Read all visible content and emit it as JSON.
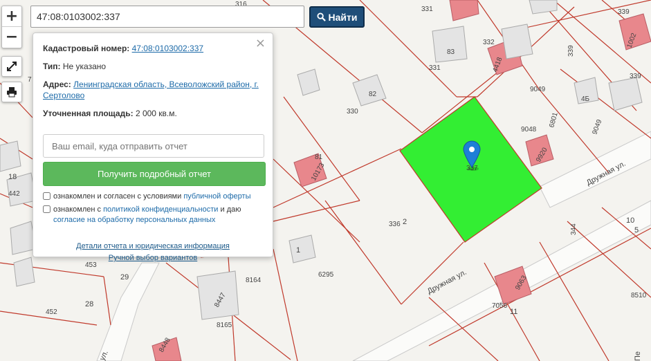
{
  "search": {
    "value": "47:08:0103002:337",
    "button_label": "Найти"
  },
  "map_controls": {
    "zoom_in": "+",
    "zoom_out": "−"
  },
  "popup": {
    "close": "×",
    "cadastral_label": "Кадастровый номер:",
    "cadastral_value": "47:08:0103002:337",
    "type_label": "Тип:",
    "type_value": "Не указано",
    "address_label": "Адрес:",
    "address_value": "Ленинградская область, Всеволожский район, г. Сертолово",
    "area_label": "Уточненная площадь:",
    "area_value": "2 000 кв.м.",
    "email_placeholder": "Ваш email, куда отправить отчет",
    "report_button": "Получить подробный отчет",
    "check1_text": "ознакомлен и согласен с условиями ",
    "check1_link": "публичной оферты",
    "check2_text": "ознакомлен с ",
    "check2_link1": "политикой конфиденциальности",
    "check2_mid": " и даю ",
    "check2_link2": "согласие на обработку персональных данных",
    "details_link": "Детали отчета и юридическая информация",
    "manual_link": "Ручной выбор вариантов"
  },
  "map_labels": {
    "l331a": "331",
    "l339a": "339",
    "l1002": "1002",
    "l83": "83",
    "l332": "332",
    "l4418": "4418",
    "l331b": "331",
    "l339b": "339",
    "l339c": "339",
    "l82": "82",
    "l9049a": "9049",
    "l4b": "4Б",
    "l330": "330",
    "l6801": "6801",
    "l9049b": "9049",
    "l9048": "9048",
    "l9920": "9920",
    "l337": "337",
    "l81": "81",
    "l10173": "10173",
    "l18": "18",
    "l442": "442",
    "l336": "336",
    "l2": "2",
    "l10": "10",
    "l344": "344",
    "l5": "5",
    "l1": "1",
    "l453": "453",
    "l29": "29",
    "l8164": "8164",
    "l6295": "6295",
    "l28": "28",
    "l452": "452",
    "l8447": "8447",
    "l9063": "9063",
    "l7056": "7056",
    "l11": "11",
    "l8510": "8510",
    "l8165": "8165",
    "l8448": "8448",
    "l7": "7",
    "l316": "316",
    "street1": "Дружная ул.",
    "street2": "Дружная ул.",
    "street3": "ул.",
    "street4": "Пе"
  },
  "colors": {
    "parcel_selected": "#33ee33",
    "parcel_border": "#c0392b",
    "building": "#e8878c",
    "search_button": "#1f4e79",
    "report_button": "#5cb85c",
    "marker": "#1e7fd6"
  }
}
